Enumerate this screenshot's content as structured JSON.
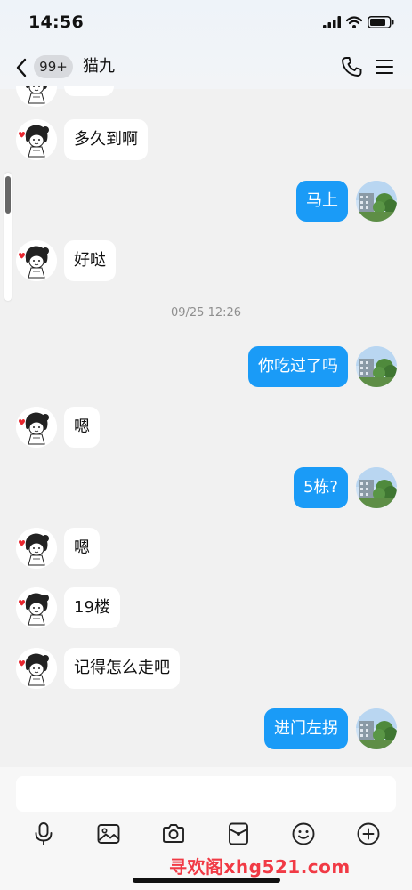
{
  "status_bar": {
    "time": "14:56",
    "icons": [
      "cellular-signal-icon",
      "wifi-icon",
      "battery-icon"
    ]
  },
  "header": {
    "back_icon": "chevron-left-icon",
    "unread_count": "99+",
    "title": "猫九",
    "actions": [
      "phone-icon",
      "menu-icon"
    ]
  },
  "messages": [
    {
      "from": "them",
      "text": "多久到啊"
    },
    {
      "from": "me",
      "text": "马上"
    },
    {
      "from": "them",
      "text": "好哒"
    },
    {
      "type": "timestamp",
      "text": "09/25 12:26"
    },
    {
      "from": "me",
      "text": "你吃过了吗"
    },
    {
      "from": "them",
      "text": "嗯"
    },
    {
      "from": "me",
      "text": "5栋?"
    },
    {
      "from": "them",
      "text": "嗯"
    },
    {
      "from": "them",
      "text": "19楼"
    },
    {
      "from": "them",
      "text": "记得怎么走吧"
    },
    {
      "from": "me",
      "text": "进门左拐"
    }
  ],
  "composer": {
    "input_value": "",
    "tools": [
      "microphone-icon",
      "image-icon",
      "camera-icon",
      "red-packet-icon",
      "emoji-icon",
      "plus-icon"
    ]
  },
  "watermark": "寻欢阁xhg521.com",
  "colors": {
    "outgoing_bubble": "#1a9bf7",
    "incoming_bubble": "#ffffff",
    "background": "#f1f1f1",
    "watermark": "#f13a45"
  }
}
